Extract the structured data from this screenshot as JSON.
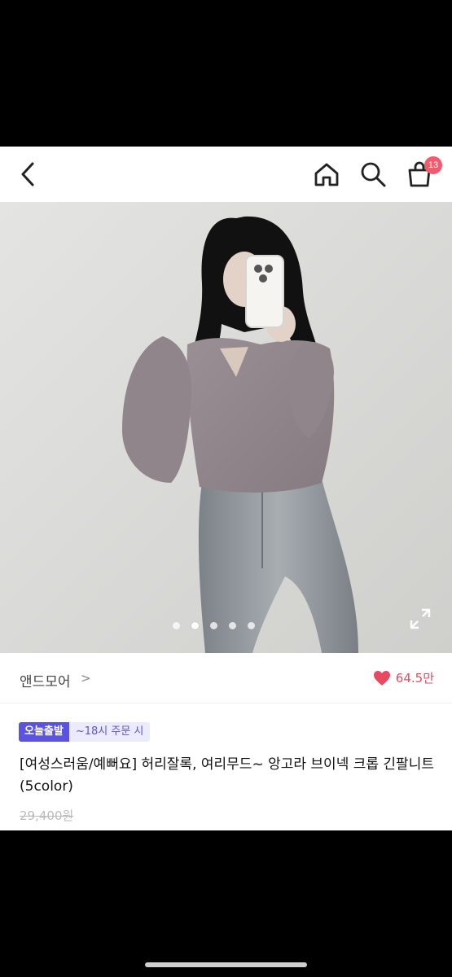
{
  "header": {
    "cart_count": "13",
    "icons": [
      "back-icon",
      "home-icon",
      "search-icon",
      "cart-icon"
    ]
  },
  "gallery": {
    "dot_count": 5,
    "active_index": 1,
    "icons": [
      "expand-icon"
    ]
  },
  "store": {
    "name": "앤드모어",
    "chevron": ">",
    "likes": "64.5만",
    "like_color": "#e84a61"
  },
  "product": {
    "badge": "오늘출발",
    "badge_note": "~18시 주문 시",
    "title": "[여성스러움/예뻐요] 허리잘록, 여리무드~ 앙고라 브이넥 크롭 긴팔니트 (5color)",
    "price": "29,400원",
    "accent_color": "#5a53e0"
  }
}
